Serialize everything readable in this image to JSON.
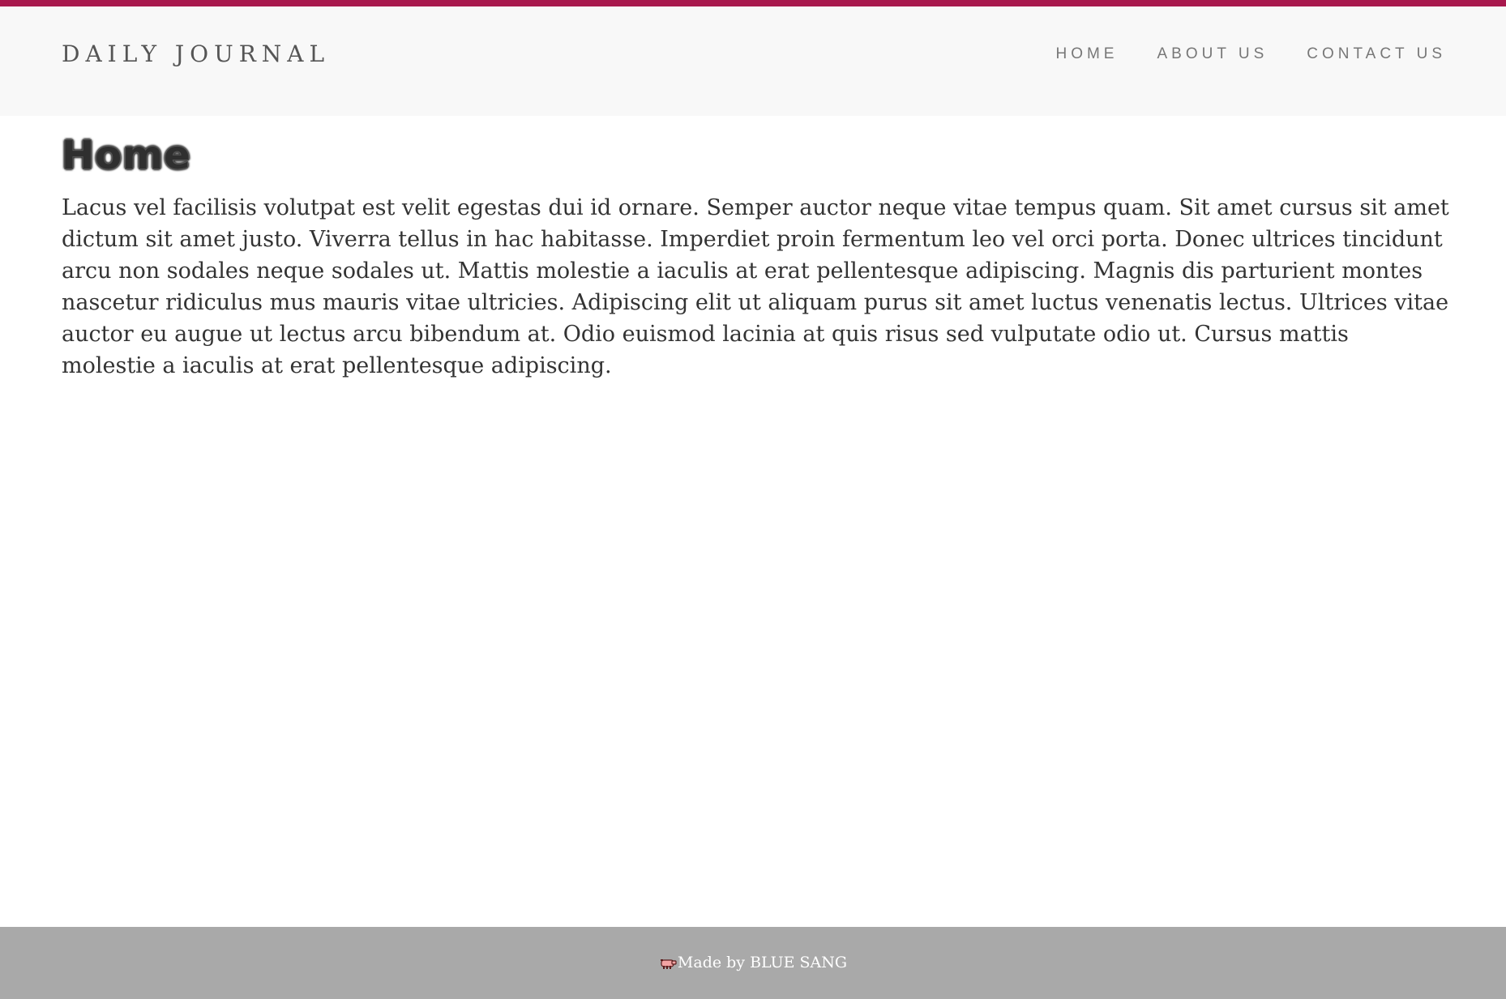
{
  "header": {
    "brand": "DAILY JOURNAL",
    "nav": [
      {
        "label": "HOME"
      },
      {
        "label": "ABOUT US"
      },
      {
        "label": "CONTACT US"
      }
    ]
  },
  "main": {
    "title": "Home",
    "paragraph": "Lacus vel facilisis volutpat est velit egestas dui id ornare. Semper auctor neque vitae tempus quam. Sit amet cursus sit amet dictum sit amet justo. Viverra tellus in hac habitasse. Imperdiet proin fermentum leo vel orci porta. Donec ultrices tincidunt arcu non sodales neque sodales ut. Mattis molestie a iaculis at erat pellentesque adipiscing. Magnis dis parturient montes nascetur ridiculus mus mauris vitae ultricies. Adipiscing elit ut aliquam purus sit amet luctus venenatis lectus. Ultrices vitae auctor eu augue ut lectus arcu bibendum at. Odio euismod lacinia at quis risus sed vulputate odio ut. Cursus mattis molestie a iaculis at erat pellentesque adipiscing."
  },
  "footer": {
    "icon": "pig-icon",
    "text": "Made by BLUE SANG"
  },
  "colors": {
    "accent": "#a8184d",
    "navbar_bg": "#f8f8f8",
    "footer_bg": "#a9a9a9"
  }
}
